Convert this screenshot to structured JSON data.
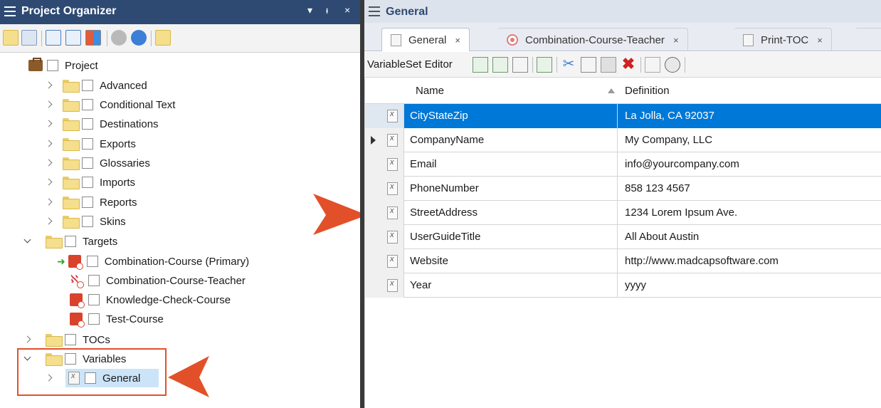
{
  "left_panel": {
    "title": "Project Organizer",
    "title_controls": [
      "▾",
      "ᵻ",
      "×"
    ],
    "tree": {
      "project": "Project",
      "folders": [
        "Advanced",
        "Conditional Text",
        "Destinations",
        "Exports",
        "Glossaries",
        "Imports",
        "Reports",
        "Skins"
      ],
      "targets_folder": "Targets",
      "targets": [
        "Combination-Course (Primary)",
        "Combination-Course-Teacher",
        "Knowledge-Check-Course",
        "Test-Course"
      ],
      "tocs": "TOCs",
      "variables_folder": "Variables",
      "variable_set": "General"
    }
  },
  "right_panel": {
    "title": "General",
    "tabs": [
      {
        "label": "General",
        "close": "×",
        "active": true
      },
      {
        "label": "Combination-Course-Teacher",
        "close": "×",
        "active": false
      },
      {
        "label": "Print-TOC",
        "close": "×",
        "active": false
      }
    ],
    "editor_label": "VariableSet Editor",
    "columns": {
      "name": "Name",
      "definition": "Definition"
    },
    "rows": [
      {
        "name": "CityStateZip",
        "definition": "La Jolla, CA 92037"
      },
      {
        "name": "CompanyName",
        "definition": "My Company, LLC"
      },
      {
        "name": "Email",
        "definition": "info@yourcompany.com"
      },
      {
        "name": "PhoneNumber",
        "definition": "858 123 4567"
      },
      {
        "name": "StreetAddress",
        "definition": "1234 Lorem Ipsum Ave."
      },
      {
        "name": "UserGuideTitle",
        "definition": "All About Austin"
      },
      {
        "name": "Website",
        "definition": "http://www.madcapsoftware.com"
      },
      {
        "name": "Year",
        "definition": "yyyy"
      }
    ]
  },
  "colors": {
    "accent_title": "#2e4a73",
    "selection": "#0078d7",
    "callout_arrow": "#e2502a"
  }
}
